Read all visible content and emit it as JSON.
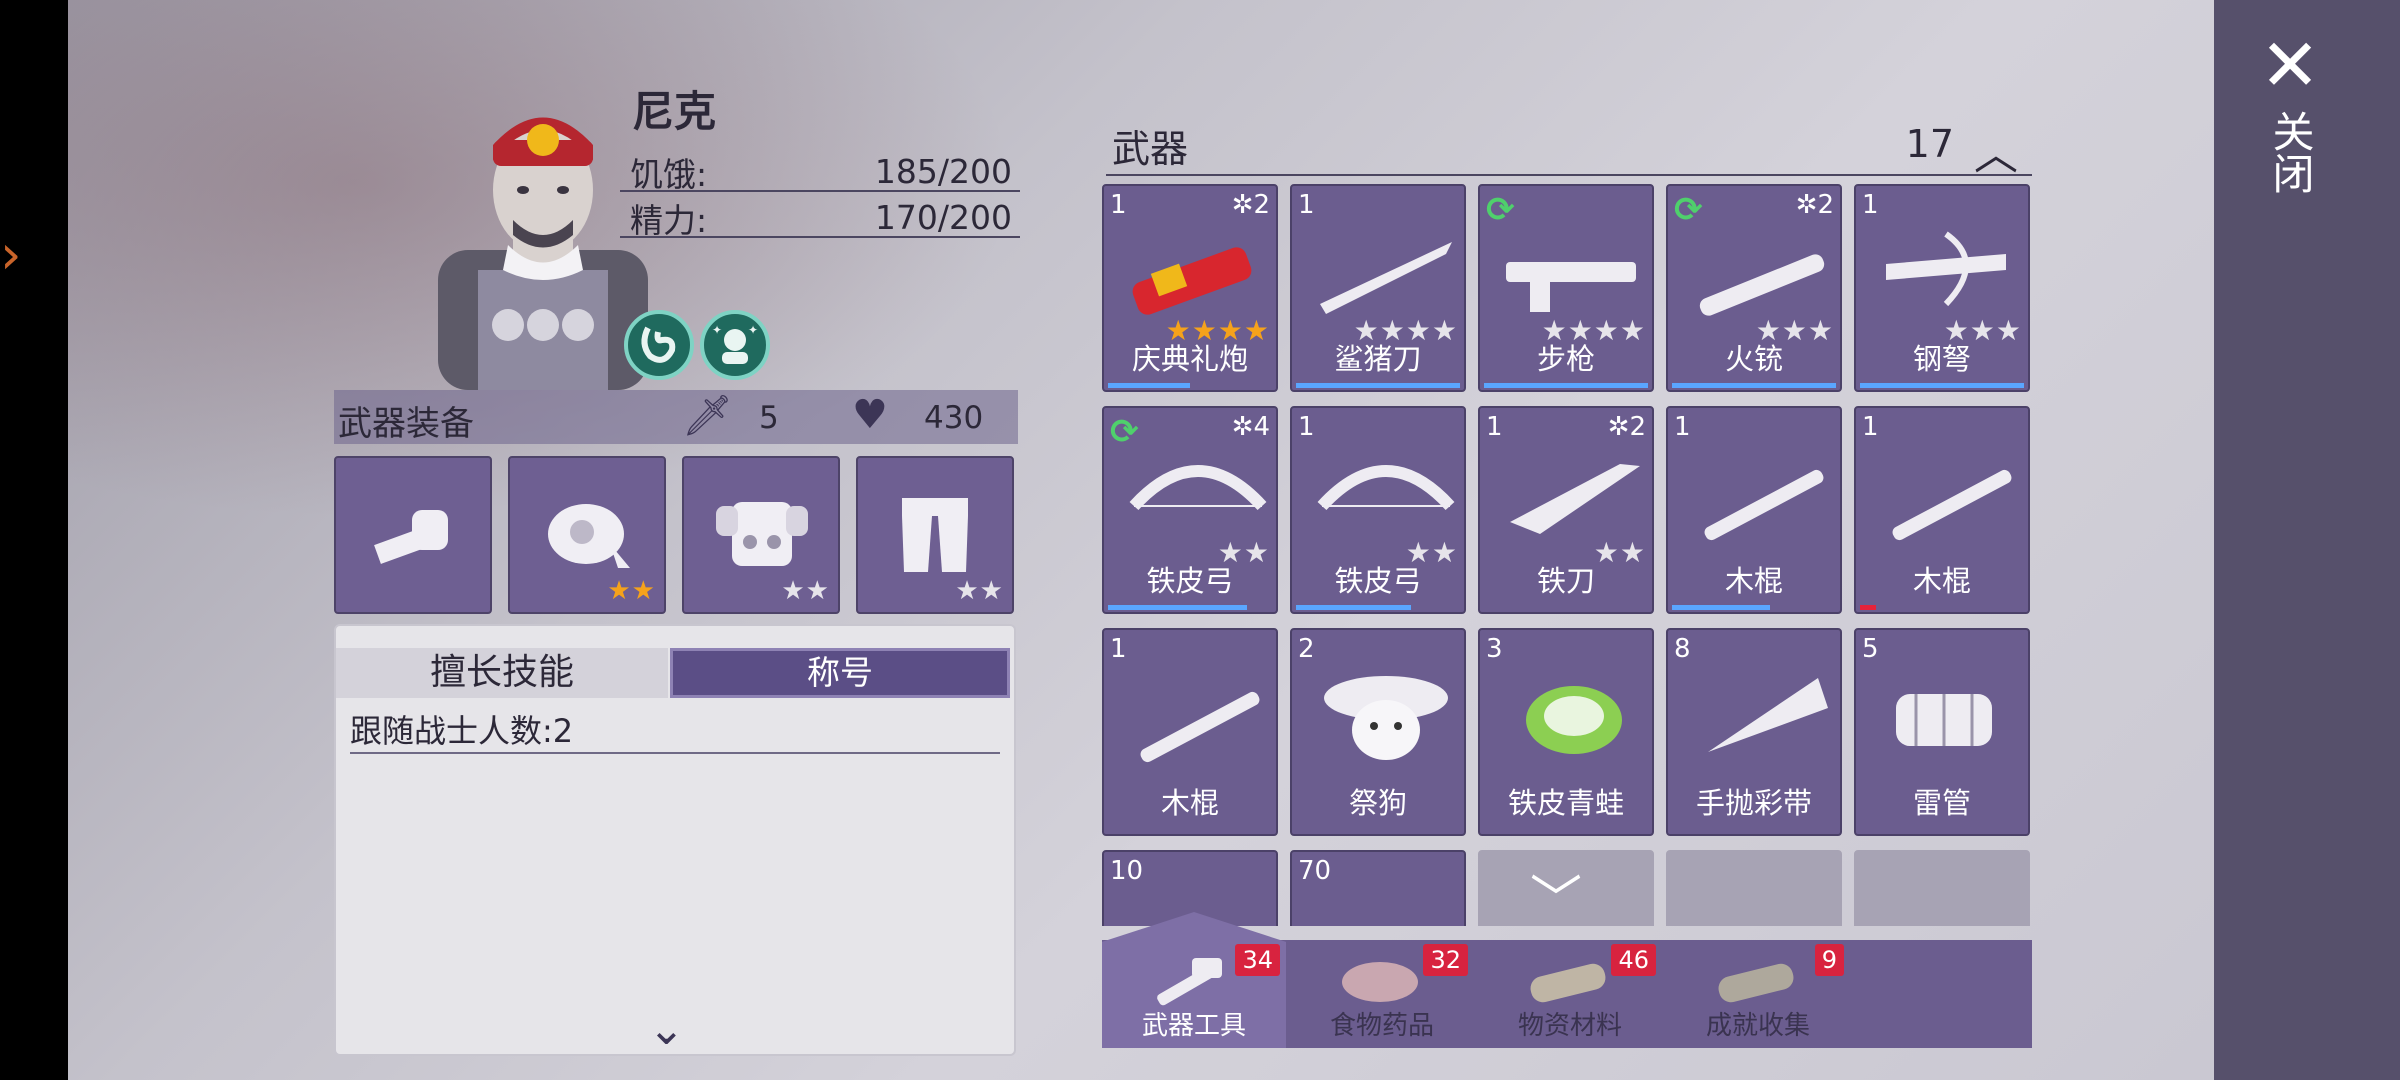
{
  "close": {
    "label": "关闭"
  },
  "character": {
    "name": "尼克",
    "hunger_label": "饥饿:",
    "hunger_value": "185/200",
    "energy_label": "精力:",
    "energy_value": "170/200"
  },
  "equipment": {
    "title": "武器装备",
    "attack": "5",
    "health": "430",
    "slots": [
      {
        "name": "fist",
        "stars": ""
      },
      {
        "name": "bandana",
        "stars": "★★"
      },
      {
        "name": "armor",
        "stars": "★★"
      },
      {
        "name": "pants",
        "stars": "★★"
      }
    ]
  },
  "skills": {
    "tab_skill": "擅长技能",
    "tab_title": "称号",
    "follower_text": "跟随战士人数:2"
  },
  "weapons": {
    "title": "武器",
    "count": "17",
    "items": [
      {
        "qty": "1",
        "lvl": "✲2",
        "name": "庆典礼炮",
        "stars": "★★★★",
        "gold": true,
        "bar": 0.5
      },
      {
        "qty": "1",
        "lvl": "",
        "name": "鲨猪刀",
        "stars": "★★★★",
        "gold": false,
        "bar": 1.0
      },
      {
        "qty": "",
        "lvl": "",
        "refresh": true,
        "name": "步枪",
        "stars": "★★★★",
        "gold": false,
        "bar": 1.0
      },
      {
        "qty": "",
        "lvl": "✲2",
        "refresh": true,
        "name": "火铳",
        "stars": "★★★",
        "gold": false,
        "bar": 1.0
      },
      {
        "qty": "1",
        "lvl": "",
        "name": "钢弩",
        "stars": "★★★",
        "gold": false,
        "bar": 1.0
      },
      {
        "qty": "",
        "lvl": "✲4",
        "refresh": true,
        "name": "铁皮弓",
        "stars": "★★",
        "gold": false,
        "bar": 0.85
      },
      {
        "qty": "1",
        "lvl": "",
        "name": "铁皮弓",
        "stars": "★★",
        "gold": false,
        "bar": 0.7
      },
      {
        "qty": "1",
        "lvl": "✲2",
        "name": "铁刀",
        "stars": "★★",
        "gold": false,
        "bar": 0
      },
      {
        "qty": "1",
        "lvl": "",
        "name": "木棍",
        "stars": "",
        "gold": false,
        "bar": 0.6
      },
      {
        "qty": "1",
        "lvl": "",
        "name": "木棍",
        "stars": "",
        "gold": false,
        "bar": 0.1,
        "bar_red": true
      },
      {
        "qty": "1",
        "lvl": "",
        "name": "木棍",
        "stars": "",
        "gold": false,
        "bar": 0
      },
      {
        "qty": "2",
        "lvl": "",
        "name": "祭狗",
        "stars": "",
        "gold": false,
        "bar": 0
      },
      {
        "qty": "3",
        "lvl": "",
        "name": "铁皮青蛙",
        "stars": "",
        "gold": false,
        "bar": 0
      },
      {
        "qty": "8",
        "lvl": "",
        "name": "手抛彩带",
        "stars": "",
        "gold": false,
        "bar": 0
      },
      {
        "qty": "5",
        "lvl": "",
        "name": "雷管",
        "stars": "",
        "gold": false,
        "bar": 0
      },
      {
        "qty": "10",
        "lvl": "",
        "name": "",
        "stars": "",
        "gold": false,
        "bar": 0
      },
      {
        "qty": "70",
        "lvl": "",
        "name": "",
        "stars": "",
        "gold": false,
        "bar": 0
      }
    ]
  },
  "tabs": [
    {
      "label": "武器工具",
      "badge": "34",
      "active": true
    },
    {
      "label": "食物药品",
      "badge": "32",
      "active": false
    },
    {
      "label": "物资材料",
      "badge": "46",
      "active": false
    },
    {
      "label": "成就收集",
      "badge": "9",
      "active": false
    }
  ],
  "colors": {
    "accent": "#6b5d8f",
    "badge": "#d8233f",
    "gold_star": "#f5a21b",
    "refresh": "#4fd06c"
  }
}
